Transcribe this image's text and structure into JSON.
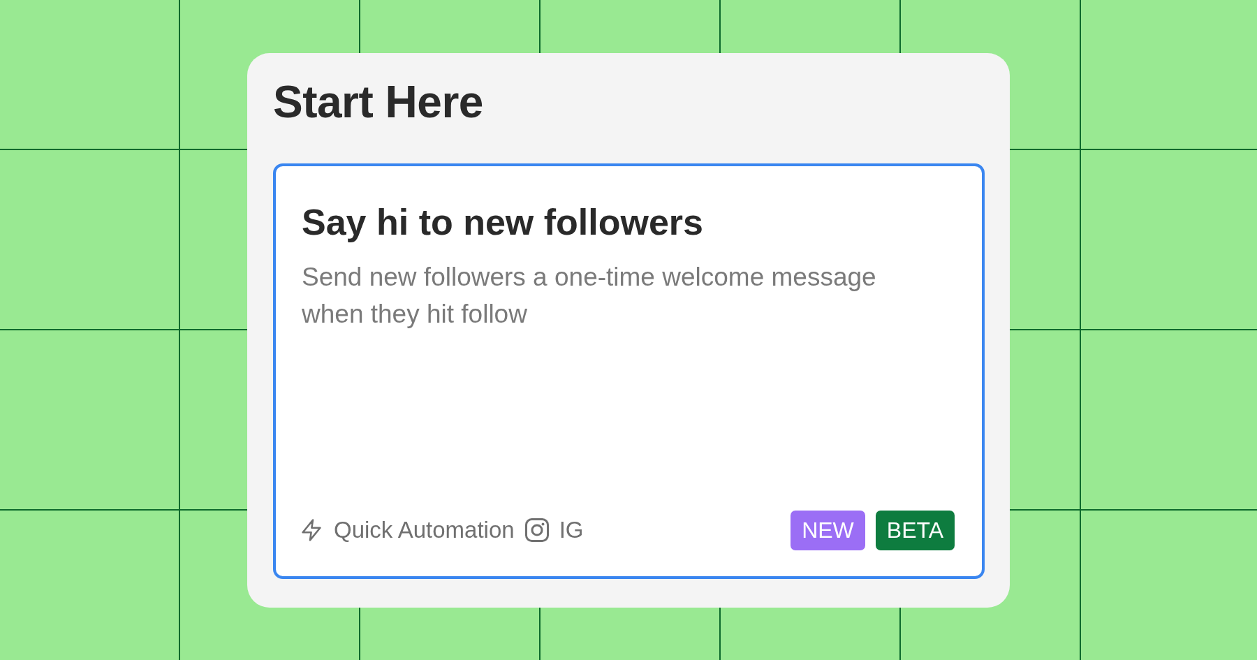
{
  "panel": {
    "title": "Start Here"
  },
  "card": {
    "selected": true,
    "title": "Say hi to new followers",
    "description": "Send new followers a one-time welcome message when they hit follow",
    "meta": [
      {
        "kind": "automation",
        "label": "Quick Automation"
      },
      {
        "kind": "channel",
        "label": "IG"
      }
    ],
    "badges": [
      {
        "label": "NEW",
        "color": "#9b6ef5"
      },
      {
        "label": "BETA",
        "color": "#0e7c3f"
      }
    ]
  }
}
